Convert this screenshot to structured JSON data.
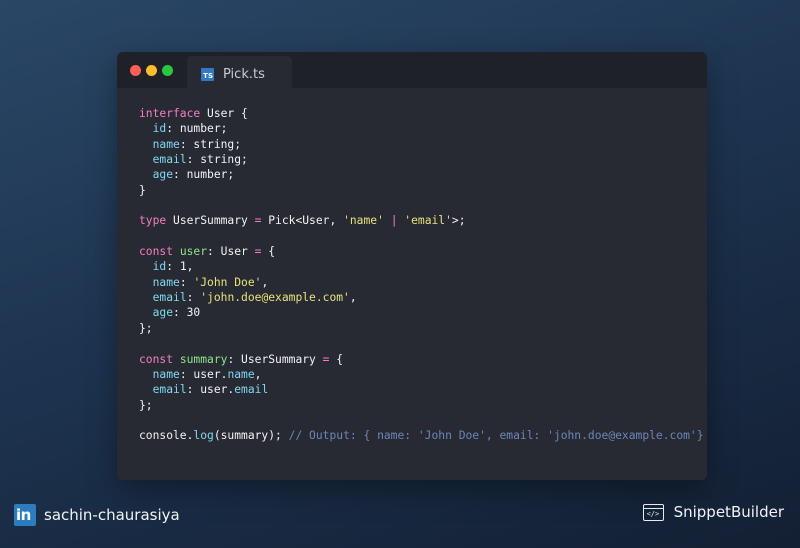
{
  "window": {
    "tab_filename": "Pick.ts",
    "tab_icon": "typescript-icon",
    "tab_icon_text": "TS",
    "traffic_lights": {
      "close": "#fe5f57",
      "minimize": "#febc2e",
      "maximize": "#28c840"
    }
  },
  "code": {
    "language": "typescript",
    "lines": [
      [
        {
          "t": "interface",
          "c": "kw"
        },
        {
          "t": " User {",
          "c": "tp"
        }
      ],
      [
        {
          "t": "  ",
          "c": "plain"
        },
        {
          "t": "id",
          "c": "prop"
        },
        {
          "t": ": number;",
          "c": "tp"
        }
      ],
      [
        {
          "t": "  ",
          "c": "plain"
        },
        {
          "t": "name",
          "c": "prop"
        },
        {
          "t": ": string;",
          "c": "tp"
        }
      ],
      [
        {
          "t": "  ",
          "c": "plain"
        },
        {
          "t": "email",
          "c": "prop"
        },
        {
          "t": ": string;",
          "c": "tp"
        }
      ],
      [
        {
          "t": "  ",
          "c": "plain"
        },
        {
          "t": "age",
          "c": "prop"
        },
        {
          "t": ": number;",
          "c": "tp"
        }
      ],
      [
        {
          "t": "}",
          "c": "tp"
        }
      ],
      [],
      [
        {
          "t": "type",
          "c": "kw"
        },
        {
          "t": " UserSummary ",
          "c": "tp"
        },
        {
          "t": "=",
          "c": "op"
        },
        {
          "t": " Pick<User, ",
          "c": "tp"
        },
        {
          "t": "'name'",
          "c": "str"
        },
        {
          "t": " | ",
          "c": "op"
        },
        {
          "t": "'email'",
          "c": "str"
        },
        {
          "t": ">;",
          "c": "tp"
        }
      ],
      [],
      [
        {
          "t": "const",
          "c": "kw"
        },
        {
          "t": " ",
          "c": "plain"
        },
        {
          "t": "user",
          "c": "var"
        },
        {
          "t": ": User ",
          "c": "tp"
        },
        {
          "t": "=",
          "c": "op"
        },
        {
          "t": " {",
          "c": "tp"
        }
      ],
      [
        {
          "t": "  ",
          "c": "plain"
        },
        {
          "t": "id",
          "c": "prop"
        },
        {
          "t": ": 1,",
          "c": "tp"
        }
      ],
      [
        {
          "t": "  ",
          "c": "plain"
        },
        {
          "t": "name",
          "c": "prop"
        },
        {
          "t": ": ",
          "c": "tp"
        },
        {
          "t": "'John Doe'",
          "c": "str"
        },
        {
          "t": ",",
          "c": "tp"
        }
      ],
      [
        {
          "t": "  ",
          "c": "plain"
        },
        {
          "t": "email",
          "c": "prop"
        },
        {
          "t": ": ",
          "c": "tp"
        },
        {
          "t": "'john.doe@example.com'",
          "c": "str"
        },
        {
          "t": ",",
          "c": "tp"
        }
      ],
      [
        {
          "t": "  ",
          "c": "plain"
        },
        {
          "t": "age",
          "c": "prop"
        },
        {
          "t": ": 30",
          "c": "tp"
        }
      ],
      [
        {
          "t": "};",
          "c": "tp"
        }
      ],
      [],
      [
        {
          "t": "const",
          "c": "kw"
        },
        {
          "t": " ",
          "c": "plain"
        },
        {
          "t": "summary",
          "c": "var"
        },
        {
          "t": ": UserSummary ",
          "c": "tp"
        },
        {
          "t": "=",
          "c": "op"
        },
        {
          "t": " {",
          "c": "tp"
        }
      ],
      [
        {
          "t": "  ",
          "c": "plain"
        },
        {
          "t": "name",
          "c": "prop"
        },
        {
          "t": ": user.",
          "c": "tp"
        },
        {
          "t": "name",
          "c": "prop"
        },
        {
          "t": ",",
          "c": "tp"
        }
      ],
      [
        {
          "t": "  ",
          "c": "plain"
        },
        {
          "t": "email",
          "c": "prop"
        },
        {
          "t": ": user.",
          "c": "tp"
        },
        {
          "t": "email",
          "c": "prop"
        }
      ],
      [
        {
          "t": "};",
          "c": "tp"
        }
      ],
      [],
      [
        {
          "t": "console.",
          "c": "tp"
        },
        {
          "t": "log",
          "c": "fn"
        },
        {
          "t": "(summary); ",
          "c": "tp"
        },
        {
          "t": "// Output: { name: 'John Doe', email: 'john.doe@example.com'}",
          "c": "cm"
        }
      ]
    ]
  },
  "footer": {
    "author": "sachin-chaurasiya",
    "author_icon": "linkedin-icon",
    "author_icon_text": "in",
    "brand": "SnippetBuilder",
    "brand_icon": "code-window-icon",
    "brand_icon_text": "</>"
  }
}
